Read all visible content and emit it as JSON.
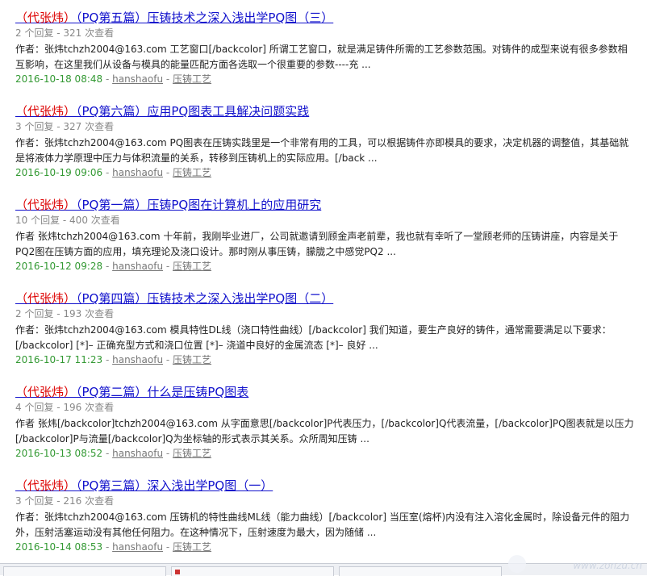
{
  "results": [
    {
      "title_hl": "（代张炜）",
      "title_rest": "（PQ第五篇）压铸技术之深入浅出学PQ图（三）",
      "stats": "2 个回复 - 321 次查看",
      "snippet": "作者：张炜tchzh2004@163.com 工艺窗口[/backcolor] 所谓工艺窗口，就是满足铸件所需的工艺参数范围。对铸件的成型来说有很多参数相互影响，在这里我们从设备与模具的能量匹配方面各选取一个很重要的参数----充 ...",
      "date": "2016-10-18 08:48",
      "author": "hanshaofu",
      "category": "压铸工艺"
    },
    {
      "title_hl": "（代张炜）",
      "title_rest": "（PQ第六篇）应用PQ图表工具解决问题实践",
      "stats": "3 个回复 - 327 次查看",
      "snippet": "作者：张炜tchzh2004@163.com PQ图表在压铸实践里是一个非常有用的工具，可以根据铸件亦即模具的要求，决定机器的调整值，其基础就是将液体力学原理中压力与体积流量的关系，转移到压铸机上的实际应用。[/back ...",
      "date": "2016-10-19 09:06",
      "author": "hanshaofu",
      "category": "压铸工艺"
    },
    {
      "title_hl": "（代张炜）",
      "title_rest": "（PQ第一篇）压铸PQ图在计算机上的应用研究",
      "stats": "10 个回复 - 400 次查看",
      "snippet": "作者 张炜tchzh2004@163.com 十年前，我刚毕业进厂，公司就邀请到顾金声老前辈，我也就有幸听了一堂顾老师的压铸讲座，内容是关于PQ2图在压铸方面的应用，填充理论及浇口设计。那时刚从事压铸，朦胧之中感觉PQ2 ...",
      "date": "2016-10-12 09:28",
      "author": "hanshaofu",
      "category": "压铸工艺"
    },
    {
      "title_hl": "（代张炜）",
      "title_rest": "（PQ第四篇）压铸技术之深入浅出学PQ图（二）",
      "stats": "2 个回复 - 193 次查看",
      "snippet": "作者：张炜tchzh2004@163.com 模具特性DL线（浇口特性曲线）[/backcolor] 我们知道，要生产良好的铸件，通常需要满足以下要求：[/backcolor] [*]– 正确充型方式和浇口位置 [*]– 浇道中良好的金属流态 [*]– 良好 ...",
      "date": "2016-10-17 11:23",
      "author": "hanshaofu",
      "category": "压铸工艺"
    },
    {
      "title_hl": "（代张炜）",
      "title_rest": "（PQ第二篇）什么是压铸PQ图表",
      "stats": "4 个回复 - 196 次查看",
      "snippet": "作者 张炜[/backcolor]tchzh2004@163.com 从字面意思[/backcolor]P代表压力，[/backcolor]Q代表流量，[/backcolor]PQ图表就是以压力[/backcolor]P与流量[/backcolor]Q为坐标轴的形式表示其关系。众所周知压铸 ...",
      "date": "2016-10-13 08:52",
      "author": "hanshaofu",
      "category": "压铸工艺"
    },
    {
      "title_hl": "（代张炜）",
      "title_rest": "（PQ第三篇）深入浅出学PQ图（一）",
      "stats": "3 个回复 - 216 次查看",
      "snippet": "作者：张炜tchzh2004@163.com 压铸机的特性曲线ML线（能力曲线）[/backcolor] 当压室(熔杯)内没有注入溶化金属时，除设备元件的阻力外，压射活塞运动没有其他任何阻力。在这种情况下，压射速度为最大，因为随储 ...",
      "date": "2016-10-14 08:53",
      "author": "hanshaofu",
      "category": "压铸工艺"
    }
  ],
  "separator": " - ",
  "watermark": "www.zonzu.cn"
}
